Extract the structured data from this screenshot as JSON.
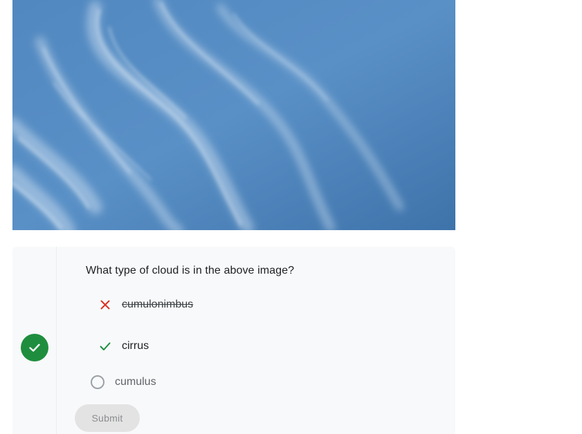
{
  "image": {
    "alt_subject": "wispy cirrus clouds in blue sky",
    "sky_color": "#4d84bb"
  },
  "quiz": {
    "question": "What type of cloud is in the above image?",
    "status": "correct",
    "status_color": "#1e8e3e",
    "options": [
      {
        "label": "cumulonimbus",
        "state": "incorrect",
        "icon": "x-icon",
        "icon_color": "#d93025"
      },
      {
        "label": "cirrus",
        "state": "correct",
        "icon": "check-icon",
        "icon_color": "#1e8e3e"
      },
      {
        "label": "cumulus",
        "state": "unselected",
        "icon": "radio-icon",
        "icon_color": "#9aa0a6"
      }
    ],
    "submit_label": "Submit",
    "submit_enabled": false
  }
}
